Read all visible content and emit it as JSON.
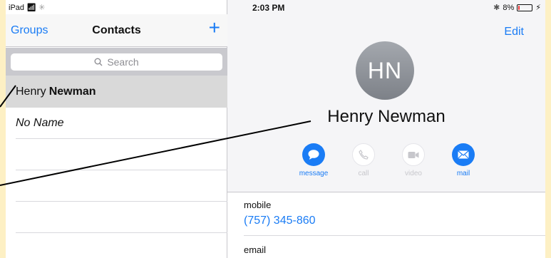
{
  "status_bar": {
    "device": "iPad",
    "time": "2:03 PM",
    "battery": "8%",
    "battery_level": 0.08
  },
  "sidebar": {
    "nav": {
      "groups_label": "Groups",
      "title": "Contacts",
      "add_label": "+"
    },
    "search": {
      "placeholder": "Search"
    },
    "contacts": [
      {
        "first": "Henry",
        "last": "Newman",
        "selected": true
      },
      {
        "label": "No Name"
      }
    ]
  },
  "detail": {
    "edit_label": "Edit",
    "initials": "HN",
    "name": "Henry Newman",
    "actions": [
      {
        "label": "message",
        "enabled": true,
        "icon": "message-icon"
      },
      {
        "label": "call",
        "enabled": false,
        "icon": "phone-icon"
      },
      {
        "label": "video",
        "enabled": false,
        "icon": "video-icon"
      },
      {
        "label": "mail",
        "enabled": true,
        "icon": "mail-icon"
      }
    ],
    "fields": [
      {
        "label": "mobile",
        "value": "(757) 345-860"
      },
      {
        "label": "email"
      }
    ]
  },
  "colors": {
    "accent": "#1a7cf5",
    "background": "#fdf0c4"
  }
}
